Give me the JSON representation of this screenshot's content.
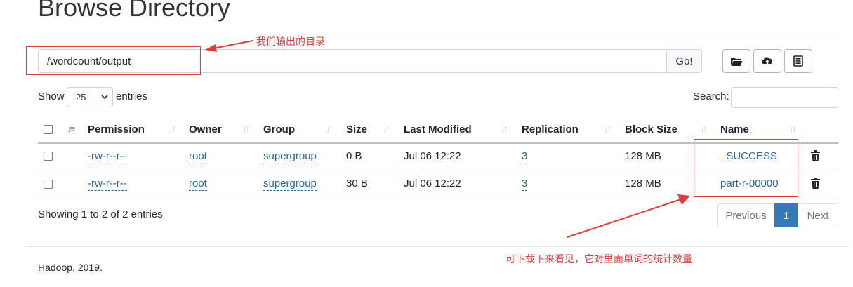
{
  "page": {
    "title": "Browse Directory"
  },
  "path_bar": {
    "value": "/wordcount/output",
    "go_label": "Go!"
  },
  "toolbar": {
    "icons": [
      "folder-open-icon",
      "upload-cloud-icon",
      "list-icon"
    ]
  },
  "annotations": {
    "output_note": "我们输出的目录",
    "download_note": "可下载下来看见，它对里面单词的统计数量"
  },
  "length_control": {
    "show_label": "Show",
    "selected": "25",
    "entries_label": "entries"
  },
  "search": {
    "label": "Search:",
    "value": ""
  },
  "table": {
    "headers": [
      "Permission",
      "Owner",
      "Group",
      "Size",
      "Last Modified",
      "Replication",
      "Block Size",
      "Name"
    ],
    "rows": [
      {
        "permission": "-rw-r--r--",
        "owner": "root",
        "group": "supergroup",
        "size": "0 B",
        "modified": "Jul 06 12:22",
        "replication": "3",
        "block_size": "128 MB",
        "name": "_SUCCESS"
      },
      {
        "permission": "-rw-r--r--",
        "owner": "root",
        "group": "supergroup",
        "size": "30 B",
        "modified": "Jul 06 12:22",
        "replication": "3",
        "block_size": "128 MB",
        "name": "part-r-00000"
      }
    ]
  },
  "table_info": "Showing 1 to 2 of 2 entries",
  "pagination": {
    "previous": "Previous",
    "current": "1",
    "next": "Next"
  },
  "footer": {
    "text": "Hadoop, 2019."
  },
  "colors": {
    "link": "#2a6496",
    "active_page": "#337ab7",
    "annotation": "#e23b3b"
  }
}
